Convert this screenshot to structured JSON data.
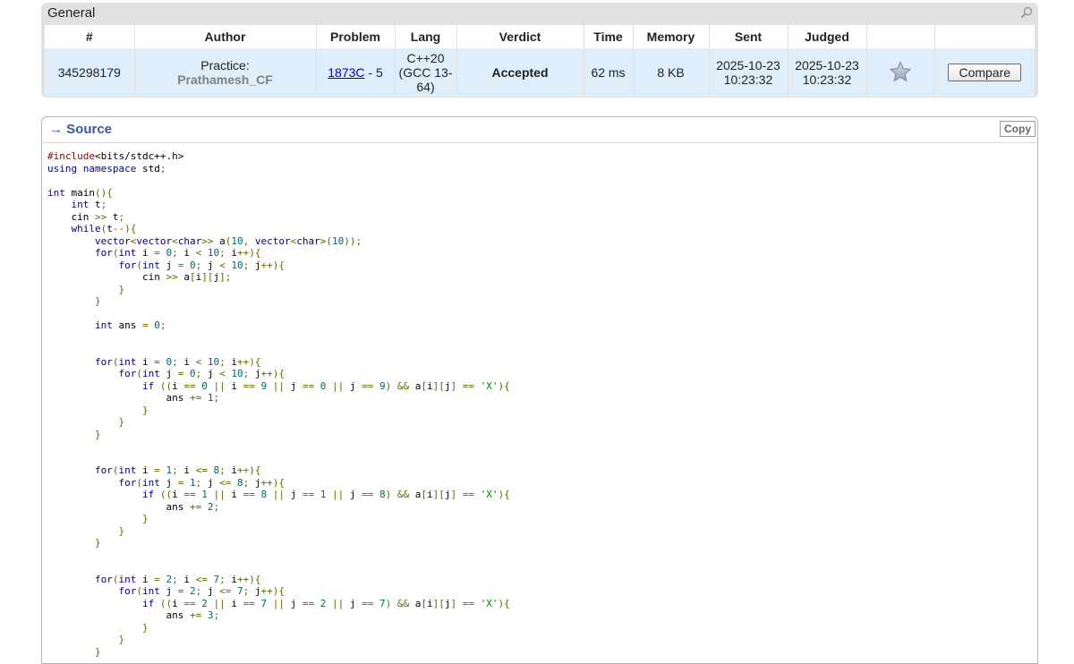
{
  "general": {
    "title": "General",
    "columns": [
      "#",
      "Author",
      "Problem",
      "Lang",
      "Verdict",
      "Time",
      "Memory",
      "Sent",
      "Judged",
      "",
      ""
    ],
    "row": {
      "id": "345298179",
      "author_label": "Practice:",
      "author_name": "Prathamesh_CF",
      "problem_link": "1873C",
      "problem_suffix": " - 5",
      "lang": "C++20 (GCC 13-64)",
      "verdict": "Accepted",
      "time": "62 ms",
      "memory": "8 KB",
      "sent": "2025-10-23 10:23:32",
      "judged": "2025-10-23 10:23:32",
      "compare_label": "Compare"
    },
    "colors": {
      "verdict": "#00aa00",
      "author": "#808080",
      "row_bg": "#dfeefb"
    }
  },
  "source": {
    "title": "→ Source",
    "copy_label": "Copy",
    "title_color": "#3b5998",
    "code": [
      "#include<bits/stdc++.h>",
      "using namespace std;",
      "",
      "int main(){",
      "    int t;",
      "    cin >> t;",
      "    while(t--){",
      "        vector<vector<char>> a(10, vector<char>(10));",
      "        for(int i = 0; i < 10; i++){",
      "            for(int j = 0; j < 10; j++){",
      "                cin >> a[i][j];",
      "            }",
      "        }",
      "",
      "        int ans = 0;",
      "",
      "",
      "        for(int i = 0; i < 10; i++){",
      "            for(int j = 0; j < 10; j++){",
      "                if ((i == 0 || i == 9 || j == 0 || j == 9) && a[i][j] == 'X'){",
      "                    ans += 1;",
      "                }",
      "            }",
      "        }",
      "",
      "",
      "        for(int i = 1; i <= 8; i++){",
      "            for(int j = 1; j <= 8; j++){",
      "                if ((i == 1 || i == 8 || j == 1 || j == 8) && a[i][j] == 'X'){",
      "                    ans += 2;",
      "                }",
      "            }",
      "        }",
      "",
      "",
      "        for(int i = 2; i <= 7; i++){",
      "            for(int j = 2; j <= 7; j++){",
      "                if ((i == 2 || i == 7 || j == 2 || j == 7) && a[i][j] == 'X'){",
      "                    ans += 3;",
      "                }",
      "            }",
      "        }"
    ]
  }
}
